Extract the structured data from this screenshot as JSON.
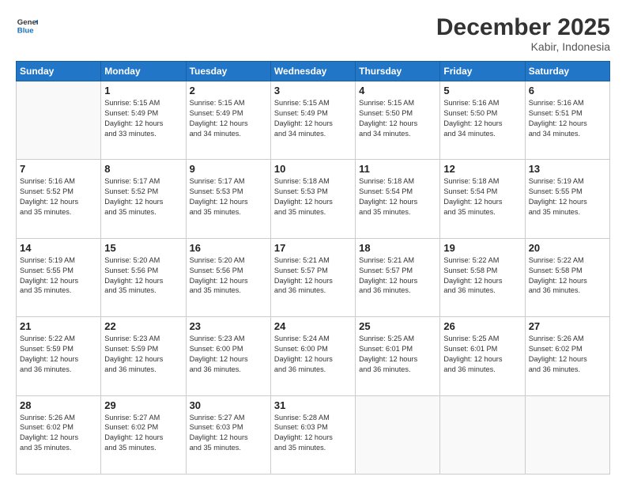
{
  "header": {
    "logo": {
      "line1": "General",
      "line2": "Blue"
    },
    "title": "December 2025",
    "location": "Kabir, Indonesia"
  },
  "weekdays": [
    "Sunday",
    "Monday",
    "Tuesday",
    "Wednesday",
    "Thursday",
    "Friday",
    "Saturday"
  ],
  "weeks": [
    [
      {
        "day": "",
        "info": ""
      },
      {
        "day": "1",
        "info": "Sunrise: 5:15 AM\nSunset: 5:49 PM\nDaylight: 12 hours\nand 33 minutes."
      },
      {
        "day": "2",
        "info": "Sunrise: 5:15 AM\nSunset: 5:49 PM\nDaylight: 12 hours\nand 34 minutes."
      },
      {
        "day": "3",
        "info": "Sunrise: 5:15 AM\nSunset: 5:49 PM\nDaylight: 12 hours\nand 34 minutes."
      },
      {
        "day": "4",
        "info": "Sunrise: 5:15 AM\nSunset: 5:50 PM\nDaylight: 12 hours\nand 34 minutes."
      },
      {
        "day": "5",
        "info": "Sunrise: 5:16 AM\nSunset: 5:50 PM\nDaylight: 12 hours\nand 34 minutes."
      },
      {
        "day": "6",
        "info": "Sunrise: 5:16 AM\nSunset: 5:51 PM\nDaylight: 12 hours\nand 34 minutes."
      }
    ],
    [
      {
        "day": "7",
        "info": "Sunrise: 5:16 AM\nSunset: 5:52 PM\nDaylight: 12 hours\nand 35 minutes."
      },
      {
        "day": "8",
        "info": "Sunrise: 5:17 AM\nSunset: 5:52 PM\nDaylight: 12 hours\nand 35 minutes."
      },
      {
        "day": "9",
        "info": "Sunrise: 5:17 AM\nSunset: 5:53 PM\nDaylight: 12 hours\nand 35 minutes."
      },
      {
        "day": "10",
        "info": "Sunrise: 5:18 AM\nSunset: 5:53 PM\nDaylight: 12 hours\nand 35 minutes."
      },
      {
        "day": "11",
        "info": "Sunrise: 5:18 AM\nSunset: 5:54 PM\nDaylight: 12 hours\nand 35 minutes."
      },
      {
        "day": "12",
        "info": "Sunrise: 5:18 AM\nSunset: 5:54 PM\nDaylight: 12 hours\nand 35 minutes."
      },
      {
        "day": "13",
        "info": "Sunrise: 5:19 AM\nSunset: 5:55 PM\nDaylight: 12 hours\nand 35 minutes."
      }
    ],
    [
      {
        "day": "14",
        "info": "Sunrise: 5:19 AM\nSunset: 5:55 PM\nDaylight: 12 hours\nand 35 minutes."
      },
      {
        "day": "15",
        "info": "Sunrise: 5:20 AM\nSunset: 5:56 PM\nDaylight: 12 hours\nand 35 minutes."
      },
      {
        "day": "16",
        "info": "Sunrise: 5:20 AM\nSunset: 5:56 PM\nDaylight: 12 hours\nand 35 minutes."
      },
      {
        "day": "17",
        "info": "Sunrise: 5:21 AM\nSunset: 5:57 PM\nDaylight: 12 hours\nand 36 minutes."
      },
      {
        "day": "18",
        "info": "Sunrise: 5:21 AM\nSunset: 5:57 PM\nDaylight: 12 hours\nand 36 minutes."
      },
      {
        "day": "19",
        "info": "Sunrise: 5:22 AM\nSunset: 5:58 PM\nDaylight: 12 hours\nand 36 minutes."
      },
      {
        "day": "20",
        "info": "Sunrise: 5:22 AM\nSunset: 5:58 PM\nDaylight: 12 hours\nand 36 minutes."
      }
    ],
    [
      {
        "day": "21",
        "info": "Sunrise: 5:22 AM\nSunset: 5:59 PM\nDaylight: 12 hours\nand 36 minutes."
      },
      {
        "day": "22",
        "info": "Sunrise: 5:23 AM\nSunset: 5:59 PM\nDaylight: 12 hours\nand 36 minutes."
      },
      {
        "day": "23",
        "info": "Sunrise: 5:23 AM\nSunset: 6:00 PM\nDaylight: 12 hours\nand 36 minutes."
      },
      {
        "day": "24",
        "info": "Sunrise: 5:24 AM\nSunset: 6:00 PM\nDaylight: 12 hours\nand 36 minutes."
      },
      {
        "day": "25",
        "info": "Sunrise: 5:25 AM\nSunset: 6:01 PM\nDaylight: 12 hours\nand 36 minutes."
      },
      {
        "day": "26",
        "info": "Sunrise: 5:25 AM\nSunset: 6:01 PM\nDaylight: 12 hours\nand 36 minutes."
      },
      {
        "day": "27",
        "info": "Sunrise: 5:26 AM\nSunset: 6:02 PM\nDaylight: 12 hours\nand 36 minutes."
      }
    ],
    [
      {
        "day": "28",
        "info": "Sunrise: 5:26 AM\nSunset: 6:02 PM\nDaylight: 12 hours\nand 35 minutes."
      },
      {
        "day": "29",
        "info": "Sunrise: 5:27 AM\nSunset: 6:02 PM\nDaylight: 12 hours\nand 35 minutes."
      },
      {
        "day": "30",
        "info": "Sunrise: 5:27 AM\nSunset: 6:03 PM\nDaylight: 12 hours\nand 35 minutes."
      },
      {
        "day": "31",
        "info": "Sunrise: 5:28 AM\nSunset: 6:03 PM\nDaylight: 12 hours\nand 35 minutes."
      },
      {
        "day": "",
        "info": ""
      },
      {
        "day": "",
        "info": ""
      },
      {
        "day": "",
        "info": ""
      }
    ]
  ]
}
